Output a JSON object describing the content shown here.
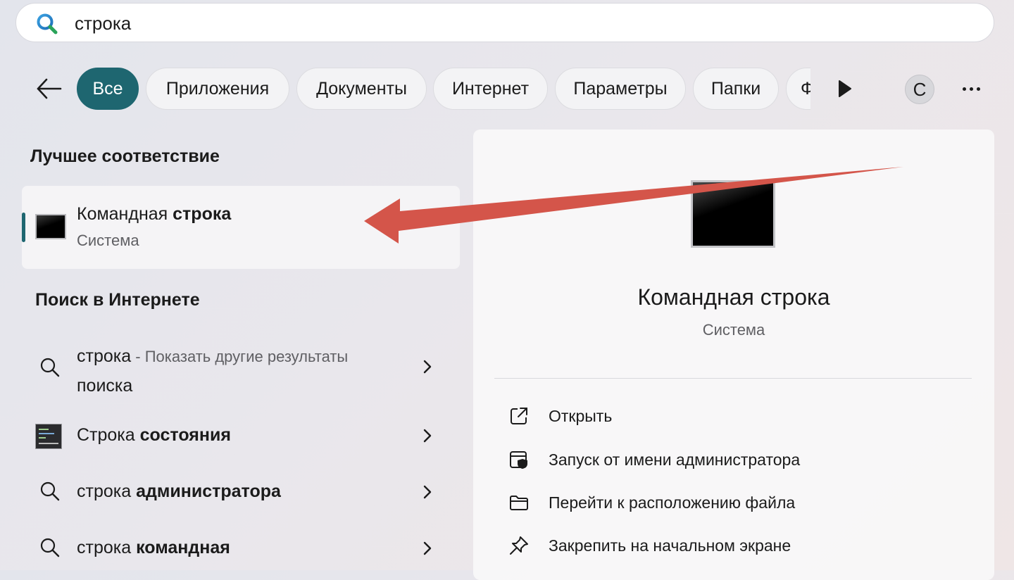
{
  "search": {
    "query": "строка"
  },
  "filters": [
    {
      "label": "Все",
      "active": true
    },
    {
      "label": "Приложения"
    },
    {
      "label": "Документы"
    },
    {
      "label": "Интернет"
    },
    {
      "label": "Параметры"
    },
    {
      "label": "Папки"
    },
    {
      "label": "Ф"
    }
  ],
  "account": {
    "initial": "С"
  },
  "best_match": {
    "heading": "Лучшее соответствие",
    "title_plain": "Командная ",
    "title_bold": "строка",
    "subtitle": "Система"
  },
  "web_search": {
    "heading": "Поиск в Интернете",
    "items": [
      {
        "plain": "строка",
        "suffix": " - Показать другие результаты",
        "suffix2": "поиска",
        "icon": "search-icon"
      },
      {
        "plain": "Строка ",
        "bold": "состояния",
        "icon": "status-bar-app-icon"
      },
      {
        "plain": "строка ",
        "bold": "администратора",
        "icon": "search-icon"
      },
      {
        "plain": "строка ",
        "bold": "командная",
        "icon": "search-icon"
      }
    ]
  },
  "detail": {
    "title": "Командная строка",
    "subtitle": "Система",
    "actions": [
      {
        "label": "Открыть",
        "icon": "open-external-icon"
      },
      {
        "label": "Запуск от имени администратора",
        "icon": "run-as-admin-icon"
      },
      {
        "label": "Перейти к расположению файла",
        "icon": "folder-icon"
      },
      {
        "label": "Закрепить на начальном экране",
        "icon": "pin-icon"
      }
    ]
  },
  "colors": {
    "accent": "#1e6670",
    "annotation_arrow": "#d4554a"
  }
}
